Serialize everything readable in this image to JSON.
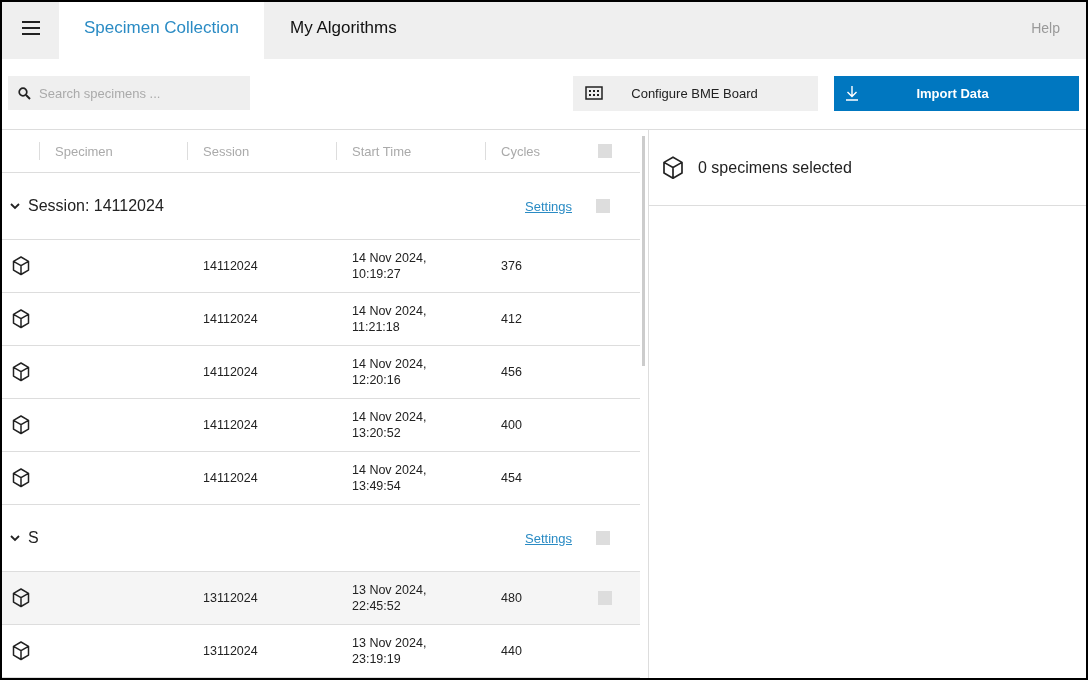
{
  "top_bar": {
    "tabs": [
      {
        "label": "Specimen Collection",
        "selected": true
      },
      {
        "label": "My Algorithms",
        "selected": false
      }
    ],
    "help": "Help"
  },
  "toolbar": {
    "search": {
      "placeholder": "Search specimens ..."
    },
    "buttons": [
      {
        "label": "Configure BME Board",
        "kind": "secondary"
      },
      {
        "label": "Import Data",
        "kind": "primary"
      }
    ]
  },
  "table": {
    "columns": [
      "Specimen",
      "Session",
      "Start Time",
      "Cycles"
    ],
    "select_all_checked": false,
    "groups": [
      {
        "title": "Session: 14112024",
        "expanded": true,
        "action": "Settings",
        "checked": false,
        "rows": [
          {
            "session": "14112024",
            "start_date": "14 Nov 2024,",
            "start_clock": "10:19:27",
            "cycles": "376",
            "hovered": false
          },
          {
            "session": "14112024",
            "start_date": "14 Nov 2024,",
            "start_clock": "11:21:18",
            "cycles": "412",
            "hovered": false
          },
          {
            "session": "14112024",
            "start_date": "14 Nov 2024,",
            "start_clock": "12:20:16",
            "cycles": "456",
            "hovered": false
          },
          {
            "session": "14112024",
            "start_date": "14 Nov 2024,",
            "start_clock": "13:20:52",
            "cycles": "400",
            "hovered": false
          },
          {
            "session": "14112024",
            "start_date": "14 Nov 2024,",
            "start_clock": "13:49:54",
            "cycles": "454",
            "hovered": false
          }
        ]
      },
      {
        "title": "S",
        "expanded": true,
        "action": "Settings",
        "checked": false,
        "rows": [
          {
            "session": "13112024",
            "start_date": "13 Nov 2024,",
            "start_clock": "22:45:52",
            "cycles": "480",
            "hovered": true
          },
          {
            "session": "13112024",
            "start_date": "13 Nov 2024,",
            "start_clock": "23:19:19",
            "cycles": "440",
            "hovered": false
          }
        ]
      }
    ]
  },
  "selection_panel": {
    "summary": "0 specimens selected"
  }
}
